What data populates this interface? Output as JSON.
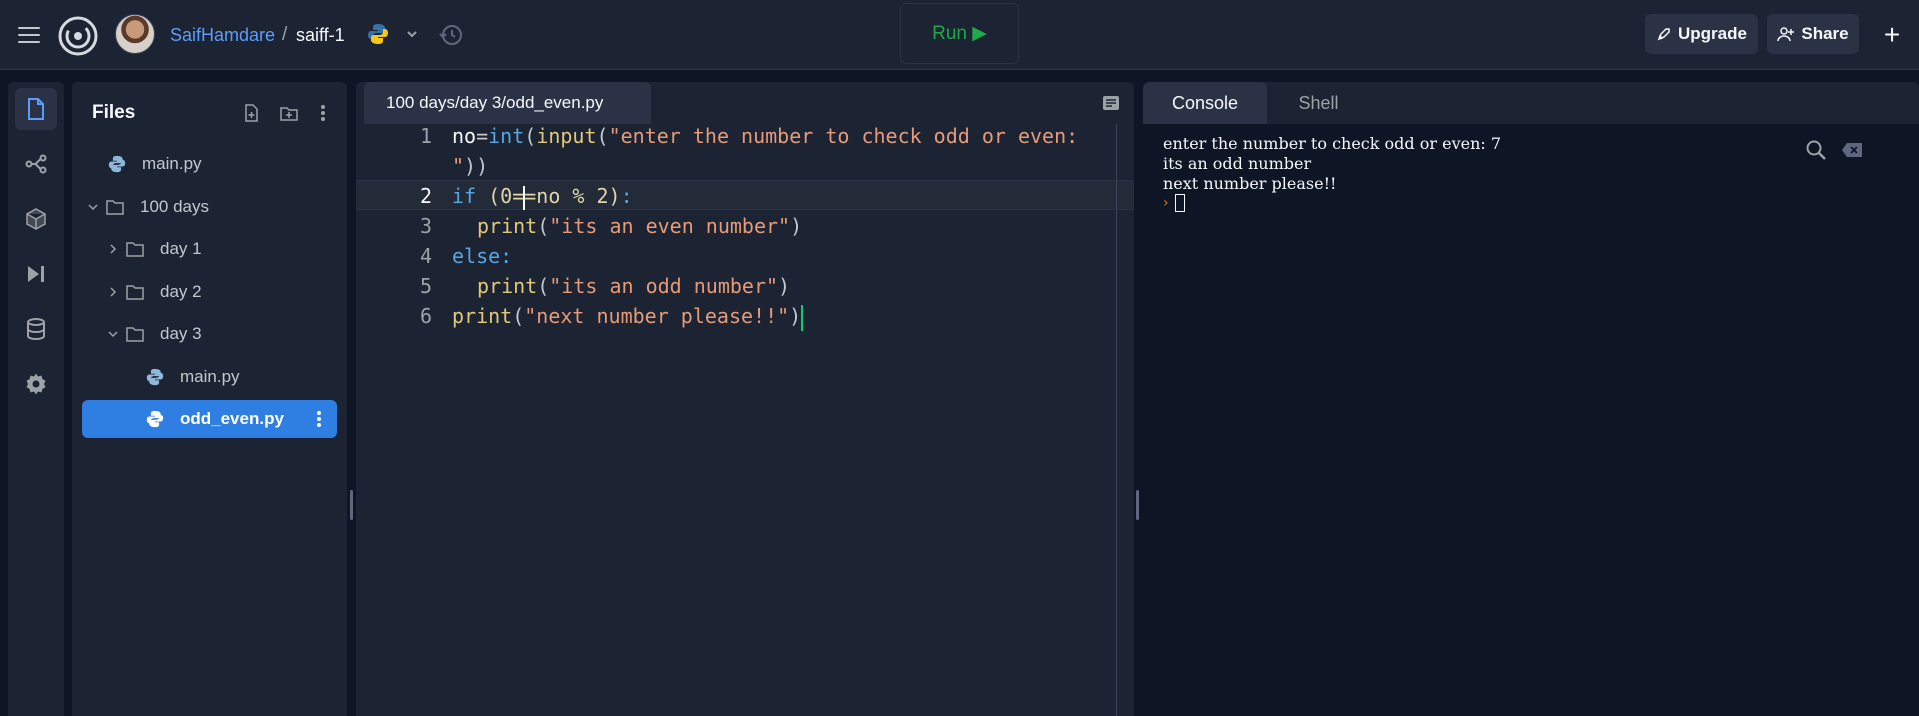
{
  "header": {
    "username": "SaifHamdare",
    "separator": "/",
    "repl_name": "saiff-1",
    "run_label": "Run ▶",
    "upgrade_label": "Upgrade",
    "share_label": "Share",
    "new_label": "+"
  },
  "colors": {
    "run_green": "#1fa84c",
    "accent_blue": "#2f7ee2",
    "username_blue": "#5b9ef9",
    "prompt_orange": "#f26722"
  },
  "rail": {
    "items": [
      "files-icon",
      "git-icon",
      "packages-icon",
      "debugger-icon",
      "database-icon",
      "settings-icon"
    ]
  },
  "files": {
    "title": "Files",
    "tree": [
      {
        "label": "main.py",
        "type": "python-file"
      },
      {
        "label": "100 days",
        "type": "folder-open"
      },
      {
        "label": "day 1",
        "type": "folder-closed"
      },
      {
        "label": "day 2",
        "type": "folder-closed"
      },
      {
        "label": "day 3",
        "type": "folder-open"
      },
      {
        "label": "main.py",
        "type": "python-file"
      },
      {
        "label": "odd_even.py",
        "type": "python-file",
        "selected": true
      }
    ]
  },
  "editor": {
    "tab_label": "100 days/day 3/odd_even.py",
    "line_numbers": [
      "1",
      "2",
      "3",
      "4",
      "5",
      "6"
    ],
    "code": {
      "l1_var": "no",
      "l1_eq": "=",
      "l1_int": "int",
      "l1_paren": "(",
      "l1_input": "input",
      "l1_paren2": "(",
      "l1_str": "\"enter the number to check odd or even:",
      "l1b_str": "\"",
      "l1b_close": "))",
      "l2_if": "if",
      "l2_open": " (0=",
      "l2_rest": "=no % 2)",
      "l2_colon": ":",
      "l3_print": "print",
      "l3_open": "(",
      "l3_str": "\"its an even number\"",
      "l3_close": ")",
      "l4_else": "else",
      "l4_colon": ":",
      "l5_print": "print",
      "l5_open": "(",
      "l5_str": "\"its an odd number\"",
      "l5_close": ")",
      "l6_print": "print",
      "l6_open": "(",
      "l6_str": "\"next number please!!\"",
      "l6_close": ")"
    }
  },
  "console": {
    "tab_console": "Console",
    "tab_shell": "Shell",
    "lines": [
      "enter the number to check odd or even: 7",
      "its an odd number",
      "next number please!!"
    ],
    "prompt": "›"
  }
}
